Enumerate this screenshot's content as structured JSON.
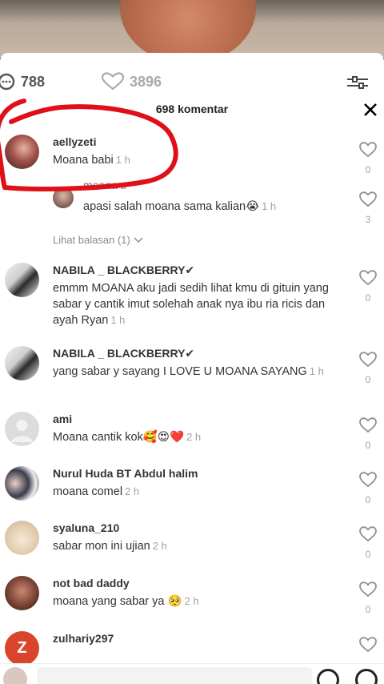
{
  "stats": {
    "comments": "788",
    "likes": "3896"
  },
  "header": {
    "title": "698 komentar"
  },
  "comments": [
    {
      "username": "aellyzeti",
      "text": "Moana babi",
      "time": "1 h",
      "likes": "0"
    },
    {
      "username": "moana ti",
      "text": "apasi salah moana sama kalian😭",
      "time": "1 h",
      "likes": "3"
    },
    {
      "username": "NABILA _ BLACKBERRY✔",
      "text": "emmm MOANA aku jadi sedih lihat kmu di gituin yang sabar y cantik imut solehah anak nya ibu ria ricis dan ayah Ryan",
      "time": "1 h",
      "likes": "0"
    },
    {
      "username": "NABILA _ BLACKBERRY✔",
      "text": "yang sabar y sayang I LOVE U MOANA SAYANG",
      "time": "1 h",
      "likes": "0"
    },
    {
      "username": "ami",
      "text": "Moana cantik kok🥰😍❤️",
      "time": "2 h",
      "likes": "0"
    },
    {
      "username": "Nurul Huda BT Abdul halim",
      "text": "moana comel",
      "time": "2 h",
      "likes": "0"
    },
    {
      "username": "syaluna_210",
      "text": "sabar mon ini ujian",
      "time": "2 h",
      "likes": "0"
    },
    {
      "username": "not bad daddy",
      "text": "moana yang sabar ya 🥺",
      "time": "2 h",
      "likes": "0"
    },
    {
      "username": "zulhariy297",
      "text": "",
      "time": "",
      "likes": ""
    }
  ],
  "view_replies": "Lihat balasan (1)",
  "avatar_letter_last": "Z",
  "colors": {
    "annotation": "#e0101a",
    "muted": "#a0a0a0"
  }
}
